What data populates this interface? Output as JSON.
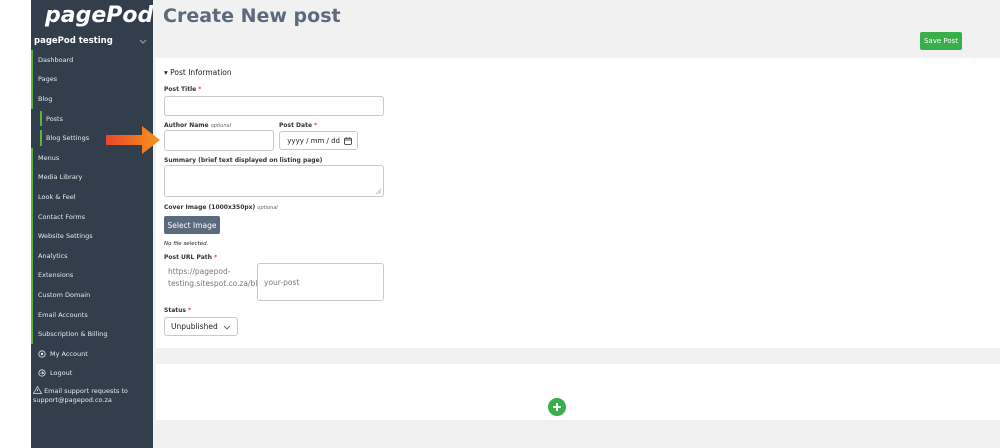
{
  "brand": {
    "name": "pagePod",
    "leaf_color": "#5fb441"
  },
  "site": {
    "name": "pagePod testing"
  },
  "nav": {
    "items": [
      {
        "label": "Dashboard"
      },
      {
        "label": "Pages"
      },
      {
        "label": "Blog"
      },
      {
        "label": "Posts"
      },
      {
        "label": "Blog Settings"
      },
      {
        "label": "Menus"
      },
      {
        "label": "Media Library"
      },
      {
        "label": "Look & Feel"
      },
      {
        "label": "Contact Forms"
      },
      {
        "label": "Website Settings"
      },
      {
        "label": "Analytics"
      },
      {
        "label": "Extensions"
      },
      {
        "label": "Custom Domain"
      },
      {
        "label": "Email Accounts"
      },
      {
        "label": "Subscription & Billing"
      },
      {
        "label": "My Account"
      },
      {
        "label": "Logout"
      }
    ],
    "support_text": "Email support requests to support@pagepod.co.za"
  },
  "page": {
    "title": "Create New post",
    "save_label": "Save Post"
  },
  "form": {
    "section_title": "▾ Post Information",
    "post_title": {
      "label": "Post Title",
      "req": "*",
      "value": ""
    },
    "author_name": {
      "label": "Author Name",
      "opt": "optional",
      "value": ""
    },
    "post_date": {
      "label": "Post Date",
      "req": "*",
      "placeholder": "yyyy / mm / dd"
    },
    "summary": {
      "label": "Summary (brief text displayed on listing page)"
    },
    "cover_image": {
      "label": "Cover Image (1000x350px)",
      "opt": "optional",
      "button": "Select Image",
      "status": "No file selected."
    },
    "url_path": {
      "label": "Post URL Path",
      "req": "*",
      "prefix": "https://pagepod-testing.sitespot.co.za/blog/",
      "value": "your-post"
    },
    "status": {
      "label": "Status",
      "req": "*",
      "value": "Unpublished"
    }
  },
  "colors": {
    "sidebar": "#323e4b",
    "accent": "#3aae4a",
    "arrow": "#f26b2a"
  }
}
